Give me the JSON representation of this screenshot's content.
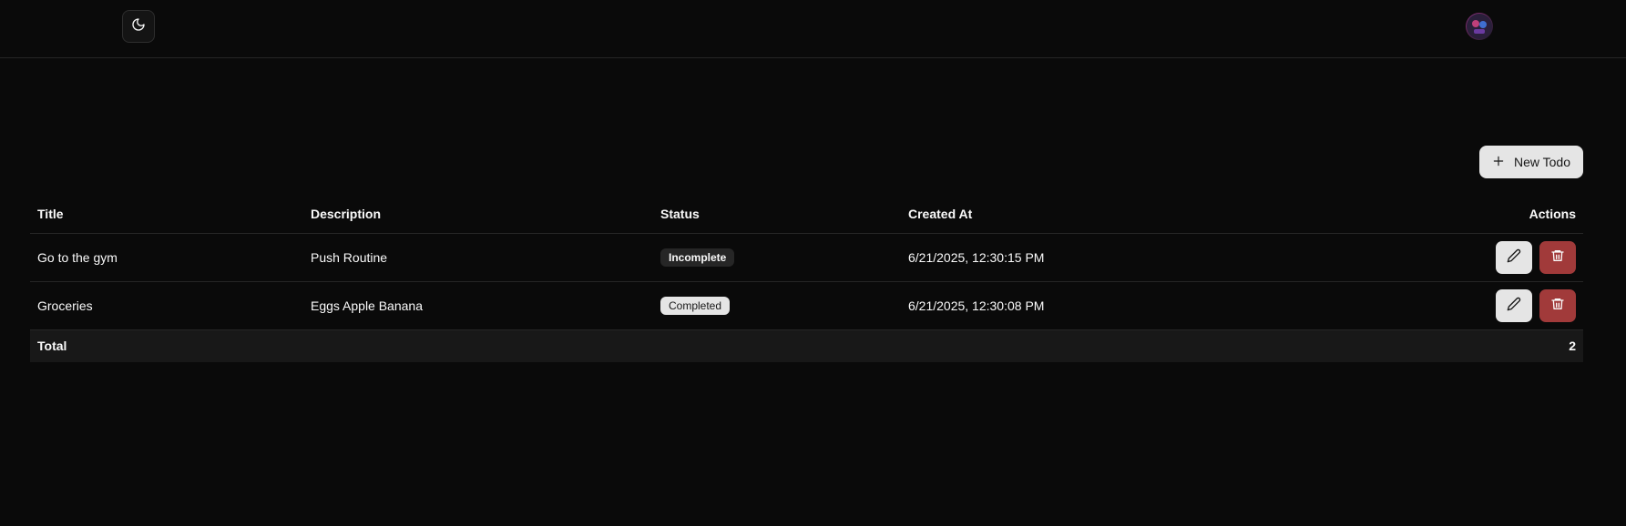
{
  "header": {
    "theme_toggle_icon": "moon-icon",
    "avatar_icon": "user-avatar"
  },
  "toolbar": {
    "new_todo_label": "New Todo",
    "new_todo_icon": "plus-icon"
  },
  "table": {
    "columns": [
      "Title",
      "Description",
      "Status",
      "Created At",
      "Actions"
    ],
    "rows": [
      {
        "title": "Go to the gym",
        "description": "Push Routine",
        "status": "Incomplete",
        "created_at": "6/21/2025, 12:30:15 PM"
      },
      {
        "title": "Groceries",
        "description": "Eggs Apple Banana",
        "status": "Completed",
        "created_at": "6/21/2025, 12:30:08 PM"
      }
    ],
    "footer": {
      "label": "Total",
      "value": "2"
    }
  },
  "colors": {
    "background": "#0a0a0a",
    "delete_button": "#a13a3a",
    "light_button": "#e5e5e5"
  }
}
